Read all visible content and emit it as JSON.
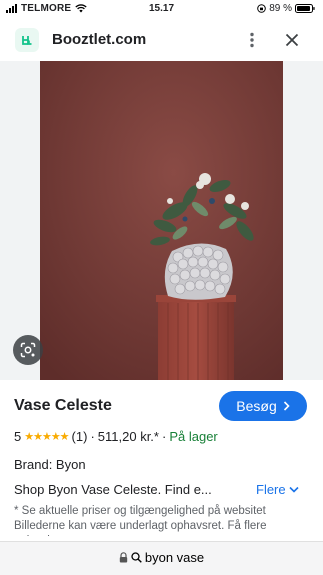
{
  "status_bar": {
    "carrier": "TELMORE",
    "time": "15.17",
    "battery": "89 %"
  },
  "header": {
    "site_name": "Booztlet.com",
    "logo_icon": "booztlet-logo-icon",
    "brand_color": "#13c38b"
  },
  "product": {
    "title": "Vase Celeste",
    "visit_label": "Besøg",
    "rating_value": "5",
    "stars": "★★★★★",
    "review_count": "(1)",
    "price": "511,20 kr.*",
    "stock": "På lager",
    "brand": "Brand: Byon",
    "description": "Shop Byon Vase Celeste. Find e...",
    "more_label": "Flere",
    "disclaimer": "* Se aktuelle priser og tilgængelighed på websitet Billederne kan være underlagt ophavsret. Få flere oplysninger"
  },
  "url_bar": {
    "query": "byon vase"
  },
  "colors": {
    "accent": "#1a73e8",
    "stock_green": "#188038",
    "star_color": "#f9ab00",
    "image_bg": "#7a3f3a"
  }
}
